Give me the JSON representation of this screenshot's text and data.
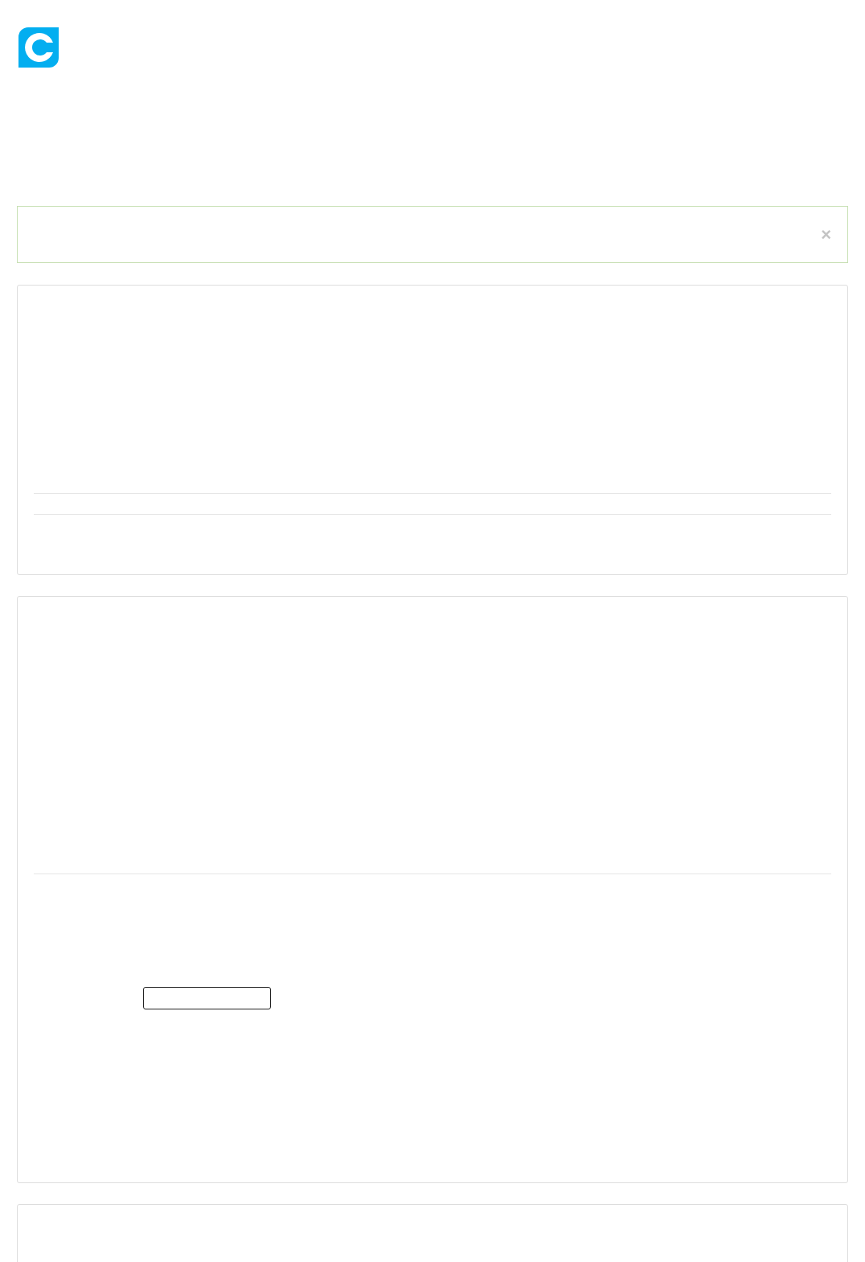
{
  "alert": {
    "close_button": "×"
  }
}
